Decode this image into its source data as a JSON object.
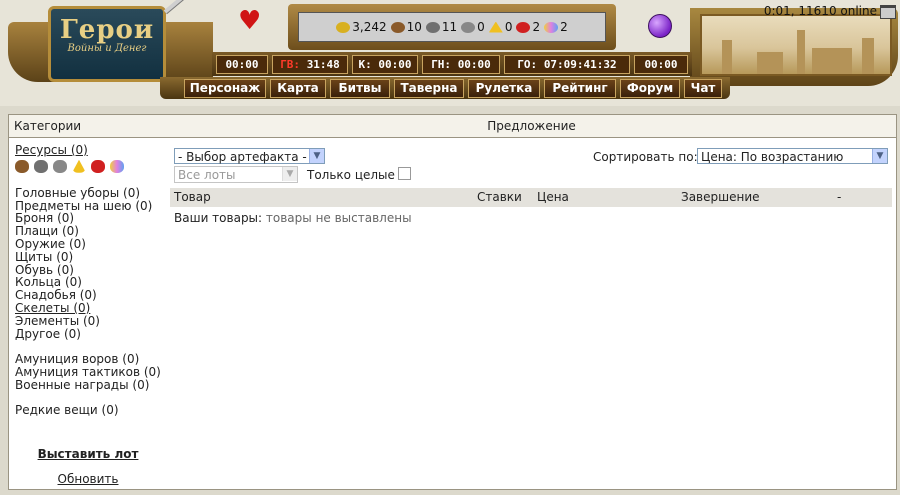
{
  "header": {
    "online": "0:01, 11610 online",
    "logo_title": "Герои",
    "logo_subtitle": "Войны и Денег",
    "resources": [
      {
        "icon": "gold-icon",
        "color": "#d8b020",
        "value": "3,242"
      },
      {
        "icon": "wood-icon",
        "color": "#8a5a2a",
        "value": "10"
      },
      {
        "icon": "ore-icon",
        "color": "#707070",
        "value": "11"
      },
      {
        "icon": "mercury-icon",
        "color": "#888888",
        "value": "0"
      },
      {
        "icon": "sulfur-icon",
        "color": "#f0c020",
        "value": "0"
      },
      {
        "icon": "crystal-icon",
        "color": "#d02020",
        "value": "2"
      },
      {
        "icon": "gems-icon",
        "color": "#e0a0e0",
        "value": "2"
      }
    ],
    "timers": [
      {
        "prefix": "",
        "value": "00:00"
      },
      {
        "prefix": "ГВ:",
        "value": "31:48"
      },
      {
        "prefix": "К:",
        "value": "00:00"
      },
      {
        "prefix": "ГН:",
        "value": "00:00"
      },
      {
        "prefix": "ГО:",
        "value": "07:09:41:32"
      },
      {
        "prefix": "",
        "value": "00:00"
      }
    ],
    "nav": [
      "Персонаж",
      "Карта",
      "Битвы",
      "Таверна",
      "Рулетка",
      "Рейтинг",
      "Форум",
      "Чат"
    ]
  },
  "left": {
    "title": "Категории",
    "resources_link": "Ресурсы (0)",
    "group1": [
      "Головные уборы (0)",
      "Предметы на шею (0)",
      "Броня (0)",
      "Плащи (0)",
      "Оружие (0)",
      "Щиты (0)",
      "Обувь (0)",
      "Кольца (0)",
      "Снадобья (0)",
      "Скелеты (0)",
      "Элементы (0)",
      "Другое (0)"
    ],
    "group2": [
      "Амуниция воров (0)",
      "Амуниция тактиков (0)",
      "Военные награды (0)"
    ],
    "group3": [
      "Редкие вещи (0)"
    ],
    "place_lot": "Выставить лот",
    "refresh": "Обновить"
  },
  "main": {
    "title": "Предложение",
    "artifact_select": "- Выбор артефакта -",
    "lots_select": "Все лоты",
    "only_whole": "Только целые",
    "sort_label": "Сортировать по:",
    "sort_value": "Цена: По возрастанию",
    "columns": [
      "Товар",
      "Ставки",
      "Цена",
      "Завершение",
      "-"
    ],
    "empty_label": "Ваши товары:",
    "empty_value": "товары не выставлены"
  },
  "colors": {
    "timer_prefix_red": "#ff3a2a",
    "frame_gold": "#b58d3a",
    "panel_border": "#9a9482"
  }
}
